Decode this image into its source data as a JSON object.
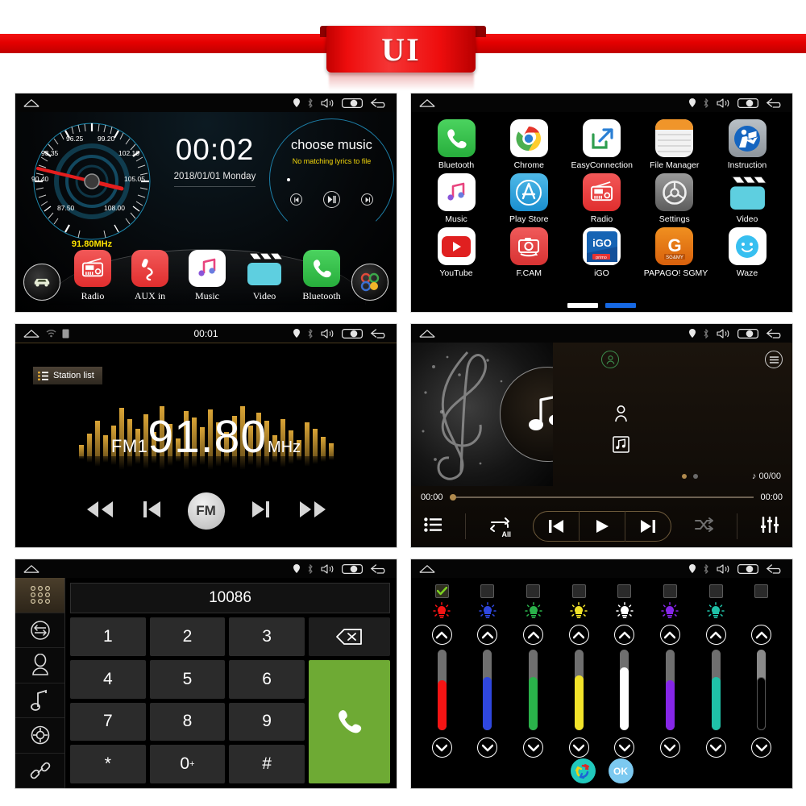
{
  "banner": {
    "label": "UI"
  },
  "statusbar": {
    "icons": [
      "home-icon",
      "location-pin-icon",
      "bluetooth-icon",
      "volume-icon",
      "brightness-slider-icon",
      "back-arrow-icon"
    ]
  },
  "dashboard": {
    "gauge": {
      "ticks": [
        "87.50",
        "90.40",
        "93.35",
        "96.25",
        "99.20",
        "102.10",
        "105.05",
        "108.00"
      ],
      "current_frequency": "91.80MHz",
      "needle_color": "#e41e1e",
      "dial_color": "#1e8ab0"
    },
    "clock": {
      "time": "00:02",
      "date": "2018/01/01  Monday"
    },
    "lyrics": {
      "title": "choose music",
      "message": "No matching lyrics to file"
    },
    "lyric_controls": [
      "prev-icon",
      "play-pause-icon",
      "next-icon"
    ],
    "dock": [
      {
        "label": "Radio",
        "icon": "radio-icon",
        "color": "#ec3f3f"
      },
      {
        "label": "AUX in",
        "icon": "aux-icon",
        "color": "#ec3f3f"
      },
      {
        "label": "Music",
        "icon": "music-note-icon",
        "color": "#ffffff"
      },
      {
        "label": "Video",
        "icon": "clapperboard-icon",
        "color": "#5ecfe0"
      },
      {
        "label": "Bluetooth",
        "icon": "phone-icon",
        "color": "#35c24a"
      }
    ],
    "side_left": {
      "icon": "car-icon"
    },
    "side_right": {
      "icon": "apps-dots-icon"
    }
  },
  "apps": {
    "rows": [
      [
        {
          "label": "Bluetooth",
          "icon": "phone-icon"
        },
        {
          "label": "Chrome",
          "icon": "chrome-icon"
        },
        {
          "label": "EasyConnection",
          "icon": "easyconnection-icon"
        },
        {
          "label": "File Manager",
          "icon": "file-manager-icon"
        },
        {
          "label": "Instruction",
          "icon": "instruction-icon"
        }
      ],
      [
        {
          "label": "Music",
          "icon": "music-note-icon"
        },
        {
          "label": "Play Store",
          "icon": "appstore-icon"
        },
        {
          "label": "Radio",
          "icon": "radio-icon"
        },
        {
          "label": "Settings",
          "icon": "gear-icon"
        },
        {
          "label": "Video",
          "icon": "clapperboard-icon"
        }
      ],
      [
        {
          "label": "YouTube",
          "icon": "youtube-icon"
        },
        {
          "label": "F.CAM",
          "icon": "camera-icon"
        },
        {
          "label": "iGO",
          "icon": "igo-icon"
        },
        {
          "label": "PAPAGO! SGMY",
          "icon": "papago-icon"
        },
        {
          "label": "Waze",
          "icon": "waze-icon"
        }
      ]
    ],
    "page_dots": [
      "inactive",
      "active"
    ],
    "igo_sub": "iGO",
    "papago_sub": "SG&MY"
  },
  "radio": {
    "statusbar_time": "00:01",
    "station_list_label": "Station list",
    "band": "FM1",
    "frequency": "91.80",
    "unit": "MHz",
    "eq_heights": [
      14,
      28,
      44,
      26,
      38,
      60,
      46,
      34,
      52,
      30,
      62,
      40,
      22,
      56,
      48,
      36,
      58,
      42,
      30,
      50,
      62,
      38,
      54,
      44,
      26,
      46,
      32,
      20,
      42,
      34,
      24,
      16
    ],
    "controls": [
      "rewind-icon",
      "prev-track-icon",
      "band-button",
      "next-track-icon",
      "fastforward-icon"
    ],
    "band_button_label": "FM"
  },
  "music_player": {
    "elapsed": "00:00",
    "total": "00:00",
    "track_counter": "00/00",
    "icons": {
      "person": "person-circle-icon",
      "menu": "menu-circle-icon",
      "artist": "artist-icon",
      "album": "album-icon",
      "note": "music-note-icon"
    },
    "bottom_controls": [
      "playlist-icon",
      "repeat-all-icon",
      "prev-track-icon",
      "play-icon",
      "next-track-icon",
      "shuffle-icon",
      "equalizer-icon"
    ],
    "repeat_label": "All",
    "page_dots": [
      "active",
      "inactive"
    ]
  },
  "dialer": {
    "number": "10086",
    "sidebar": [
      {
        "icon": "keypad-icon",
        "active": true
      },
      {
        "icon": "call-history-icon",
        "active": false
      },
      {
        "icon": "contacts-icon",
        "active": false
      },
      {
        "icon": "music-note-icon",
        "active": false
      },
      {
        "icon": "gear-icon",
        "active": false
      },
      {
        "icon": "link-icon",
        "active": false
      }
    ],
    "keys": [
      "1",
      "2",
      "3",
      "4",
      "5",
      "6",
      "7",
      "8",
      "9",
      "*",
      "0",
      "#"
    ],
    "zero_superscript": "+",
    "delete_icon": "backspace-icon",
    "call_icon": "phone-icon",
    "call_button_color": "#6eaa34"
  },
  "led_panel": {
    "channels": [
      {
        "color": "#f51414",
        "checked": true,
        "level": 62,
        "bulb": true
      },
      {
        "color": "#2f47e0",
        "checked": false,
        "level": 66,
        "bulb": true
      },
      {
        "color": "#2ab24a",
        "checked": false,
        "level": 66,
        "bulb": true
      },
      {
        "color": "#f2e32a",
        "checked": false,
        "level": 68,
        "bulb": true
      },
      {
        "color": "#ffffff",
        "checked": false,
        "level": 78,
        "bulb": true
      },
      {
        "color": "#8626e8",
        "checked": false,
        "level": 62,
        "bulb": true
      },
      {
        "color": "#1fc2a8",
        "checked": false,
        "level": 66,
        "bulb": true
      },
      {
        "color": "#0a0a0a",
        "checked": false,
        "level": 66,
        "bulb": false
      }
    ],
    "up_icon": "chevron-up-icon",
    "down_icon": "chevron-down-icon",
    "footer": {
      "refresh_icon": "refresh-cycle-icon",
      "refresh_color": "#21c9bd",
      "ok_label": "OK",
      "ok_color": "#7cc9f0"
    }
  }
}
